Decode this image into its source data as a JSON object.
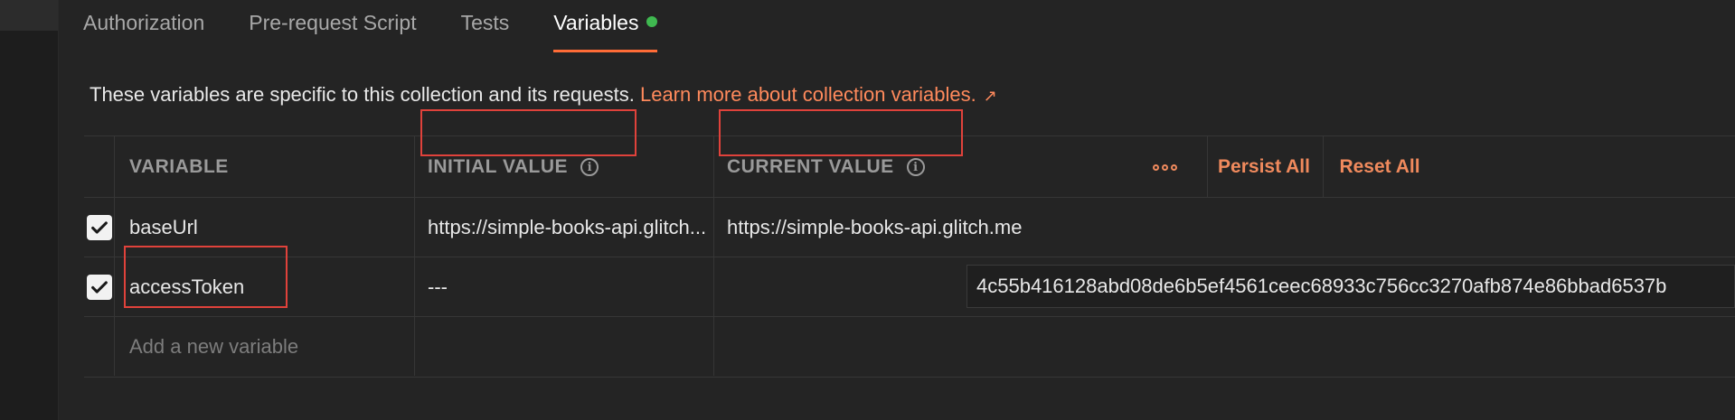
{
  "tabs": [
    {
      "label": "Authorization",
      "active": false
    },
    {
      "label": "Pre-request Script",
      "active": false
    },
    {
      "label": "Tests",
      "active": false
    },
    {
      "label": "Variables",
      "active": true,
      "indicator_color": "#3fb950"
    }
  ],
  "description": {
    "text": "These variables are specific to this collection and its requests. ",
    "link": "Learn more about collection variables.",
    "link_icon": "↗"
  },
  "table": {
    "headers": {
      "variable": "VARIABLE",
      "initial_value": "INITIAL VALUE",
      "current_value": "CURRENT VALUE"
    },
    "actions": {
      "persist_all": "Persist All",
      "reset_all": "Reset All"
    },
    "rows": [
      {
        "checked": true,
        "variable": "baseUrl",
        "initial_value": "https://simple-books-api.glitch...",
        "current_value": "https://simple-books-api.glitch.me"
      },
      {
        "checked": true,
        "variable": "accessToken",
        "initial_value": "---",
        "current_value": "4c55b416128abd08de6b5ef4561ceec68933c756cc3270afb874e86bbad6537b"
      }
    ],
    "new_variable_placeholder": "Add a new variable"
  },
  "colors": {
    "accent": "#ff6c37",
    "link": "#ff8a5c",
    "highlight": "#e0423b",
    "background": "#242424"
  }
}
